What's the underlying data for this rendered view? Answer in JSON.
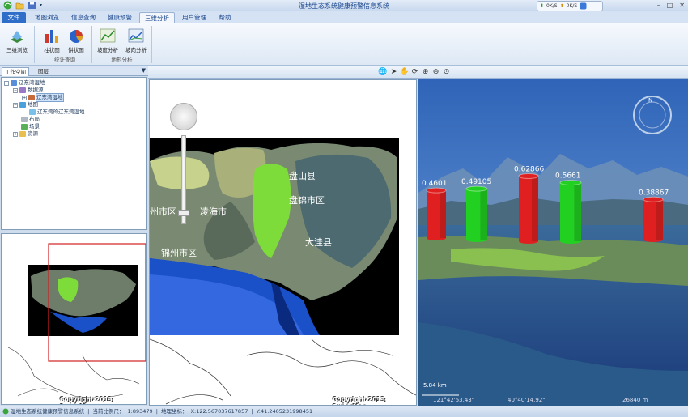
{
  "window": {
    "title": "湿地生态系统健康预警信息系统",
    "net_download": "0K/S",
    "net_upload": "0K/S"
  },
  "tabs": [
    "文件",
    "地图浏览",
    "信息查询",
    "健康预警",
    "三维分析",
    "用户管理",
    "帮助"
  ],
  "active_tab": "三维分析",
  "ribbon": {
    "buttons": {
      "scene_browse": "三维浏览",
      "bar_chart": "柱状图",
      "pie_chart": "饼状图",
      "slope": "坡度分析",
      "aspect": "坡向分析"
    },
    "groups": {
      "stats_query": "统计查询",
      "terrain_analysis": "地形分析"
    }
  },
  "panel": {
    "tabs": [
      "工作空间",
      "图层"
    ],
    "dropdown": "▼",
    "tree": {
      "root": "辽东湾湿地",
      "datasource": "数据源",
      "datasource_item": "辽东湾湿地",
      "maps": "地图",
      "map_item": "辽东湾的辽东湾湿地",
      "layout": "布局",
      "scene": "场景",
      "resource": "资源"
    }
  },
  "map2d": {
    "labels": {
      "label1": "盘山县",
      "label2": "盘锦市区",
      "label3": "凌海市",
      "label4": "锦州市区",
      "label5": "大洼县",
      "label6": "州市区"
    },
    "copyright": "Copyright 2013 SuperMap"
  },
  "overview": {
    "copyright": "Copyright 2013 SuperMap"
  },
  "scene3d": {
    "bars": [
      {
        "label": "0.4601",
        "color": "#e02020",
        "value": 0.4601
      },
      {
        "label": "0.49105",
        "color": "#22d022",
        "value": 0.49105
      },
      {
        "label": "0.62866",
        "color": "#e02020",
        "value": 0.62866
      },
      {
        "label": "0.5661",
        "color": "#22d022",
        "value": 0.5661
      },
      {
        "label": "0.38867",
        "color": "#e02020",
        "value": 0.38867
      }
    ],
    "scale": "5.84 km",
    "coord_lon": "121°42'53.43\"",
    "coord_lat": "40°40'14.92\"",
    "altitude": "26840 m"
  },
  "statusbar": {
    "system_name": "湿地生态系统健康预警信息系统",
    "scale_label": "当前比例尺：",
    "scale_value": "1:893479",
    "coord_label": "地理坐标：",
    "x_value": "X:122.567037617857",
    "y_value": "Y:41.2405231998451"
  },
  "colors": {
    "accent": "#2f6ec8",
    "ribbon_bg": "#dde8f5",
    "land_green": "#7ddc3a",
    "sea_blue": "#1a50c8"
  }
}
